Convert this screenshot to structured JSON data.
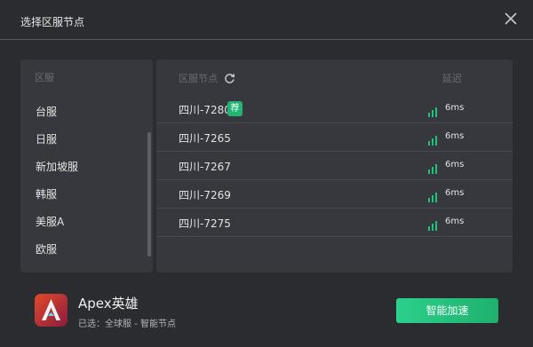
{
  "dialog": {
    "title": "选择区服节点"
  },
  "regions": {
    "header": "区服",
    "items": [
      {
        "label": "台服"
      },
      {
        "label": "日服"
      },
      {
        "label": "新加坡服"
      },
      {
        "label": "韩服"
      },
      {
        "label": "美服A"
      },
      {
        "label": "欧服"
      }
    ]
  },
  "nodes": {
    "header_node": "区服节点",
    "header_latency": "延迟",
    "rows": [
      {
        "name": "四川-7280",
        "badge": "荐",
        "latency": "6ms"
      },
      {
        "name": "四川-7265",
        "badge": "",
        "latency": "6ms"
      },
      {
        "name": "四川-7267",
        "badge": "",
        "latency": "6ms"
      },
      {
        "name": "四川-7269",
        "badge": "",
        "latency": "6ms"
      },
      {
        "name": "四川-7275",
        "badge": "",
        "latency": "6ms"
      }
    ]
  },
  "game": {
    "title": "Apex英雄",
    "selected": "已选：全球服 - 智能节点",
    "icon": "apex-logo-icon"
  },
  "actions": {
    "accelerate_label": "智能加速"
  },
  "colors": {
    "background": "#2b2c30",
    "panel": "#37383d",
    "accent_green": "#22b573"
  }
}
